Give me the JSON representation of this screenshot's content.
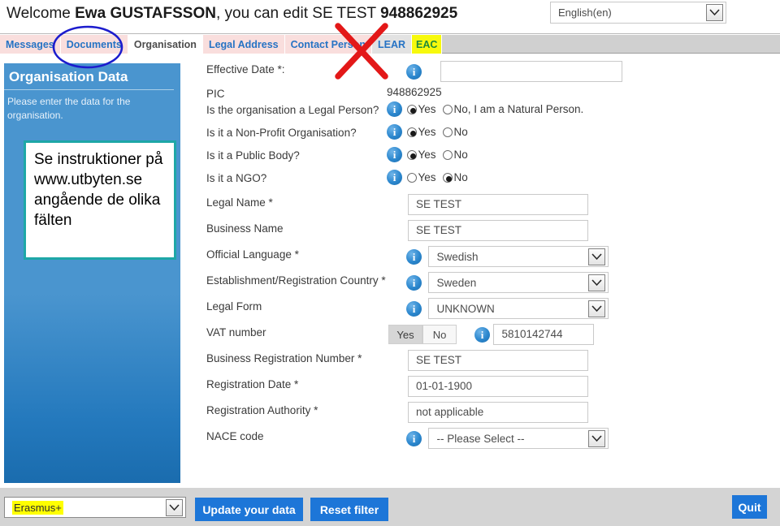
{
  "header": {
    "welcome_prefix": "Welcome ",
    "user_first": "Ewa",
    "user_last": "GUSTAFSSON",
    "welcome_middle": ", you can edit SE TEST ",
    "pic_number": "948862925",
    "language": "English(en)"
  },
  "tabs": [
    {
      "label": "Messages",
      "state": "inactive"
    },
    {
      "label": "Documents",
      "state": "inactive"
    },
    {
      "label": "Organisation",
      "state": "active"
    },
    {
      "label": "Legal Address",
      "state": "inactive"
    },
    {
      "label": "Contact Person",
      "state": "inactive"
    },
    {
      "label": "LEAR",
      "state": "plain"
    },
    {
      "label": "EAC",
      "state": "highlight"
    }
  ],
  "sidebar": {
    "title": "Organisation Data",
    "description": "Please enter the data for the organisation.",
    "note": "Se instruktioner på www.utbyten.se angående de olika fälten"
  },
  "form": {
    "rows": [
      {
        "label": "Effective Date *:",
        "info": true,
        "type": "text",
        "value": ""
      },
      {
        "label": "PIC",
        "info": false,
        "type": "static",
        "value": "948862925"
      },
      {
        "label": "Is the organisation a Legal Person?",
        "info": true,
        "type": "radio",
        "options": [
          "Yes",
          "No, I am a Natural Person."
        ],
        "selected": 0
      },
      {
        "label": "Is it a Non-Profit Organisation?",
        "info": true,
        "type": "radio",
        "options": [
          "Yes",
          "No"
        ],
        "selected": 0
      },
      {
        "label": "Is it a Public Body?",
        "info": true,
        "type": "radio",
        "options": [
          "Yes",
          "No"
        ],
        "selected": 0
      },
      {
        "label": "Is it a NGO?",
        "info": true,
        "type": "radio",
        "options": [
          "Yes",
          "No"
        ],
        "selected": 1
      },
      {
        "label": "Legal Name *",
        "info": false,
        "type": "text",
        "value": "SE TEST"
      },
      {
        "label": "Business Name",
        "info": false,
        "type": "text",
        "value": "SE TEST"
      },
      {
        "label": "Official Language *",
        "info": true,
        "type": "select",
        "value": "Swedish"
      },
      {
        "label": "Establishment/Registration Country *",
        "info": true,
        "type": "select",
        "value": "Sweden"
      },
      {
        "label": "Legal Form",
        "info": true,
        "type": "select",
        "value": "UNKNOWN"
      },
      {
        "label": "VAT number",
        "info": true,
        "type": "toggle",
        "options": [
          "Yes",
          "No"
        ],
        "selected": 0,
        "value": "5810142744"
      },
      {
        "label": "Business Registration Number *",
        "info": false,
        "type": "text",
        "value": "SE TEST"
      },
      {
        "label": "Registration Date *",
        "info": false,
        "type": "text",
        "value": "01-01-1900"
      },
      {
        "label": "Registration Authority *",
        "info": false,
        "type": "text",
        "value": "not applicable"
      },
      {
        "label": "NACE code",
        "info": true,
        "type": "select",
        "value": "-- Please Select --"
      }
    ],
    "info_glyph": "i"
  },
  "footer": {
    "programme": "Erasmus+",
    "update_label": "Update your data",
    "reset_label": "Reset filter",
    "quit_label": "Quit"
  },
  "annotations": {
    "circle_color": "#1c1ccd",
    "x_color": "#e31818",
    "highlight_color": "#ffff00"
  }
}
